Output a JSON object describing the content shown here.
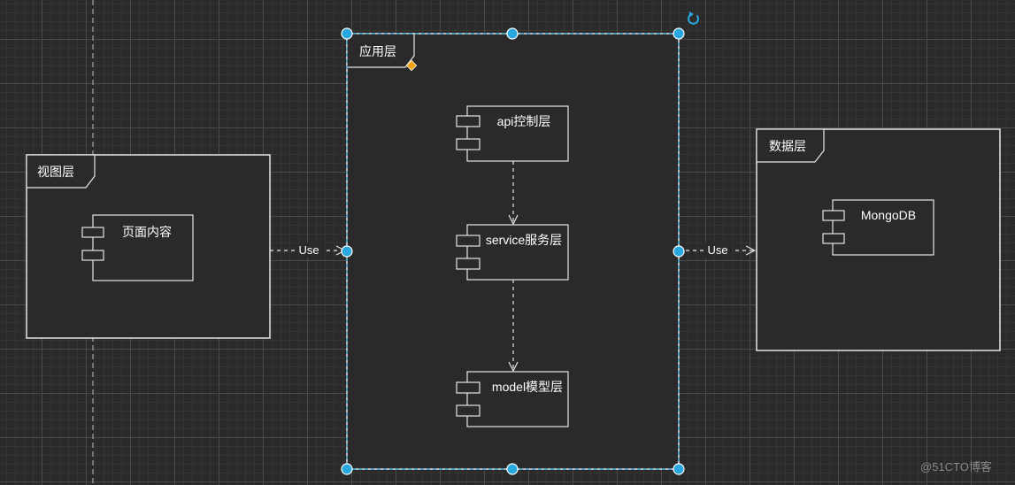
{
  "packages": {
    "view": {
      "title": "视图层"
    },
    "app": {
      "title": "应用层"
    },
    "data": {
      "title": "数据层"
    }
  },
  "components": {
    "page_content": "页面内容",
    "api_control": "api控制层",
    "service": "service服务层",
    "model": "model模型层",
    "mongodb": "MongoDB"
  },
  "connectors": {
    "view_to_app": "Use",
    "app_to_data": "Use"
  },
  "watermark": "@51CTO博客",
  "colors": {
    "background": "#2a2a2a",
    "stroke": "#e6e6e6",
    "box_fill": "#2a2a2a",
    "selection": "#29a8e0",
    "handle": "#29a8e0",
    "anchor_diamond": "#f0a30a"
  }
}
